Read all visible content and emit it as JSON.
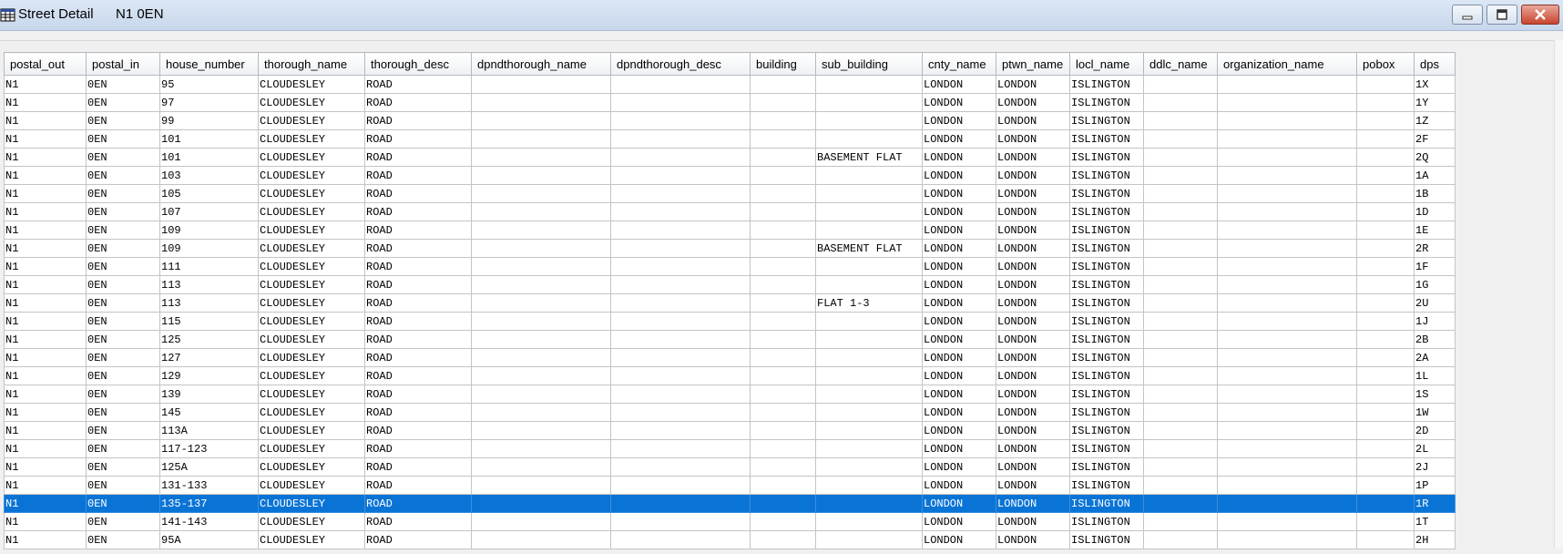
{
  "window": {
    "title": "Street Detail",
    "postcode": "N1 0EN"
  },
  "table": {
    "columns": [
      "postal_out",
      "postal_in",
      "house_number",
      "thorough_name",
      "thorough_desc",
      "dpndthorough_name",
      "dpndthorough_desc",
      "building",
      "sub_building",
      "cnty_name",
      "ptwn_name",
      "locl_name",
      "ddlc_name",
      "organization_name",
      "pobox",
      "dps"
    ],
    "selected_row_index": 23,
    "rows": [
      [
        "N1",
        "0EN",
        "95",
        "CLOUDESLEY",
        "ROAD",
        "",
        "",
        "",
        "",
        "LONDON",
        "LONDON",
        "ISLINGTON",
        "",
        "",
        "",
        "1X"
      ],
      [
        "N1",
        "0EN",
        "97",
        "CLOUDESLEY",
        "ROAD",
        "",
        "",
        "",
        "",
        "LONDON",
        "LONDON",
        "ISLINGTON",
        "",
        "",
        "",
        "1Y"
      ],
      [
        "N1",
        "0EN",
        "99",
        "CLOUDESLEY",
        "ROAD",
        "",
        "",
        "",
        "",
        "LONDON",
        "LONDON",
        "ISLINGTON",
        "",
        "",
        "",
        "1Z"
      ],
      [
        "N1",
        "0EN",
        "101",
        "CLOUDESLEY",
        "ROAD",
        "",
        "",
        "",
        "",
        "LONDON",
        "LONDON",
        "ISLINGTON",
        "",
        "",
        "",
        "2F"
      ],
      [
        "N1",
        "0EN",
        "101",
        "CLOUDESLEY",
        "ROAD",
        "",
        "",
        "",
        "BASEMENT FLAT",
        "LONDON",
        "LONDON",
        "ISLINGTON",
        "",
        "",
        "",
        "2Q"
      ],
      [
        "N1",
        "0EN",
        "103",
        "CLOUDESLEY",
        "ROAD",
        "",
        "",
        "",
        "",
        "LONDON",
        "LONDON",
        "ISLINGTON",
        "",
        "",
        "",
        "1A"
      ],
      [
        "N1",
        "0EN",
        "105",
        "CLOUDESLEY",
        "ROAD",
        "",
        "",
        "",
        "",
        "LONDON",
        "LONDON",
        "ISLINGTON",
        "",
        "",
        "",
        "1B"
      ],
      [
        "N1",
        "0EN",
        "107",
        "CLOUDESLEY",
        "ROAD",
        "",
        "",
        "",
        "",
        "LONDON",
        "LONDON",
        "ISLINGTON",
        "",
        "",
        "",
        "1D"
      ],
      [
        "N1",
        "0EN",
        "109",
        "CLOUDESLEY",
        "ROAD",
        "",
        "",
        "",
        "",
        "LONDON",
        "LONDON",
        "ISLINGTON",
        "",
        "",
        "",
        "1E"
      ],
      [
        "N1",
        "0EN",
        "109",
        "CLOUDESLEY",
        "ROAD",
        "",
        "",
        "",
        "BASEMENT FLAT",
        "LONDON",
        "LONDON",
        "ISLINGTON",
        "",
        "",
        "",
        "2R"
      ],
      [
        "N1",
        "0EN",
        "111",
        "CLOUDESLEY",
        "ROAD",
        "",
        "",
        "",
        "",
        "LONDON",
        "LONDON",
        "ISLINGTON",
        "",
        "",
        "",
        "1F"
      ],
      [
        "N1",
        "0EN",
        "113",
        "CLOUDESLEY",
        "ROAD",
        "",
        "",
        "",
        "",
        "LONDON",
        "LONDON",
        "ISLINGTON",
        "",
        "",
        "",
        "1G"
      ],
      [
        "N1",
        "0EN",
        "113",
        "CLOUDESLEY",
        "ROAD",
        "",
        "",
        "",
        "FLAT 1-3",
        "LONDON",
        "LONDON",
        "ISLINGTON",
        "",
        "",
        "",
        "2U"
      ],
      [
        "N1",
        "0EN",
        "115",
        "CLOUDESLEY",
        "ROAD",
        "",
        "",
        "",
        "",
        "LONDON",
        "LONDON",
        "ISLINGTON",
        "",
        "",
        "",
        "1J"
      ],
      [
        "N1",
        "0EN",
        "125",
        "CLOUDESLEY",
        "ROAD",
        "",
        "",
        "",
        "",
        "LONDON",
        "LONDON",
        "ISLINGTON",
        "",
        "",
        "",
        "2B"
      ],
      [
        "N1",
        "0EN",
        "127",
        "CLOUDESLEY",
        "ROAD",
        "",
        "",
        "",
        "",
        "LONDON",
        "LONDON",
        "ISLINGTON",
        "",
        "",
        "",
        "2A"
      ],
      [
        "N1",
        "0EN",
        "129",
        "CLOUDESLEY",
        "ROAD",
        "",
        "",
        "",
        "",
        "LONDON",
        "LONDON",
        "ISLINGTON",
        "",
        "",
        "",
        "1L"
      ],
      [
        "N1",
        "0EN",
        "139",
        "CLOUDESLEY",
        "ROAD",
        "",
        "",
        "",
        "",
        "LONDON",
        "LONDON",
        "ISLINGTON",
        "",
        "",
        "",
        "1S"
      ],
      [
        "N1",
        "0EN",
        "145",
        "CLOUDESLEY",
        "ROAD",
        "",
        "",
        "",
        "",
        "LONDON",
        "LONDON",
        "ISLINGTON",
        "",
        "",
        "",
        "1W"
      ],
      [
        "N1",
        "0EN",
        "113A",
        "CLOUDESLEY",
        "ROAD",
        "",
        "",
        "",
        "",
        "LONDON",
        "LONDON",
        "ISLINGTON",
        "",
        "",
        "",
        "2D"
      ],
      [
        "N1",
        "0EN",
        "117-123",
        "CLOUDESLEY",
        "ROAD",
        "",
        "",
        "",
        "",
        "LONDON",
        "LONDON",
        "ISLINGTON",
        "",
        "",
        "",
        "2L"
      ],
      [
        "N1",
        "0EN",
        "125A",
        "CLOUDESLEY",
        "ROAD",
        "",
        "",
        "",
        "",
        "LONDON",
        "LONDON",
        "ISLINGTON",
        "",
        "",
        "",
        "2J"
      ],
      [
        "N1",
        "0EN",
        "131-133",
        "CLOUDESLEY",
        "ROAD",
        "",
        "",
        "",
        "",
        "LONDON",
        "LONDON",
        "ISLINGTON",
        "",
        "",
        "",
        "1P"
      ],
      [
        "N1",
        "0EN",
        "135-137",
        "CLOUDESLEY",
        "ROAD",
        "",
        "",
        "",
        "",
        "LONDON",
        "LONDON",
        "ISLINGTON",
        "",
        "",
        "",
        "1R"
      ],
      [
        "N1",
        "0EN",
        "141-143",
        "CLOUDESLEY",
        "ROAD",
        "",
        "",
        "",
        "",
        "LONDON",
        "LONDON",
        "ISLINGTON",
        "",
        "",
        "",
        "1T"
      ],
      [
        "N1",
        "0EN",
        "95A",
        "CLOUDESLEY",
        "ROAD",
        "",
        "",
        "",
        "",
        "LONDON",
        "LONDON",
        "ISLINGTON",
        "",
        "",
        "",
        "2H"
      ]
    ]
  },
  "colors": {
    "selection": "#0a74d6",
    "titlebar": "#c6d7ec"
  },
  "icons": {
    "app": "grid-window-icon",
    "minimize": "minimize-icon",
    "maximize": "maximize-icon",
    "close": "close-icon"
  }
}
